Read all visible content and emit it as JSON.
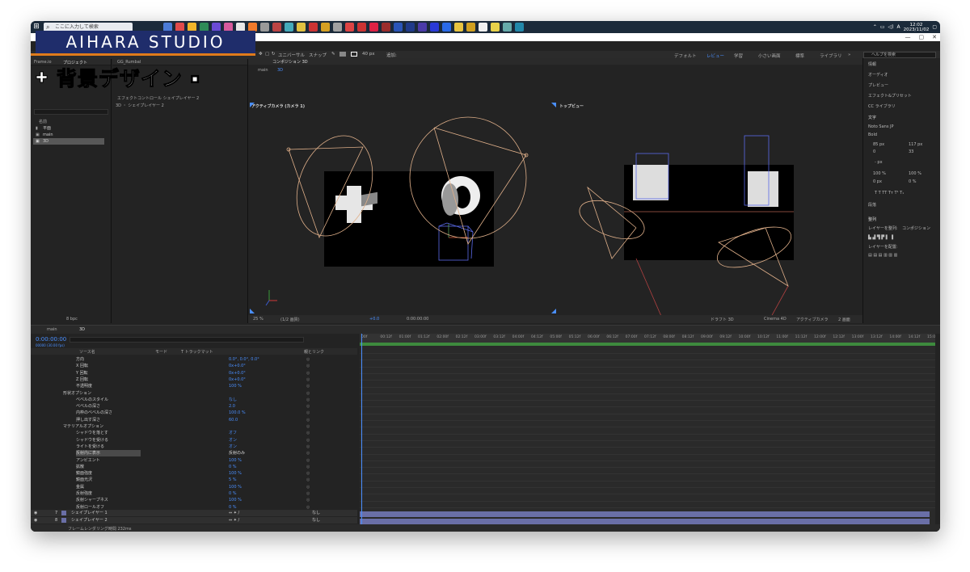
{
  "taskbar": {
    "search_placeholder": "ここに入力して検索",
    "time": "12:02",
    "date": "2023/11/02",
    "ime": "A",
    "icon_colors": [
      "#4b7bd6",
      "#e04b4b",
      "#f0b429",
      "#2e8b57",
      "#6a4bd6",
      "#d65a9c",
      "#e8e8e8",
      "#f07a2a",
      "#999",
      "#b44",
      "#4ab",
      "#e0c040",
      "#c33",
      "#d5a022",
      "#a0a0a0",
      "#d44",
      "#c33",
      "#d24",
      "#9b2d2d",
      "#2a55b8",
      "#1f3a8a",
      "#4a3aa8",
      "#2a3ad8",
      "#2a6ae8",
      "#e8c440",
      "#d0a020",
      "#f0f0f0",
      "#e8d24a",
      "#6aa",
      "#28a"
    ]
  },
  "watermark": "AIHARA STUDIO",
  "heading": "背景デザイン",
  "toolbar": {
    "universal": "ユニバーサル",
    "snap": "スナップ",
    "size": "40 px",
    "add": "追加:",
    "workspaces": [
      "デフォルト",
      "レビュー",
      "学習",
      "小さい画面",
      "標準",
      "ライブラリ"
    ],
    "active_workspace": "レビュー",
    "help_placeholder": "ヘルプを検索"
  },
  "project_panel": {
    "tabs": [
      "Frame.io",
      "プロジェクト"
    ],
    "second_tab": "GG_Rumbal",
    "effects_label": "エフェクトコントロール シェイプレイヤー 2",
    "layer_label": "3D ・ シェイプレイヤー 2",
    "name_header": "名前",
    "items": [
      {
        "icon": "folder-icon",
        "label": "平面"
      },
      {
        "icon": "comp-icon",
        "label": "main"
      },
      {
        "icon": "comp-icon",
        "label": "3D"
      }
    ],
    "bottom_bit": "8 bpc"
  },
  "composition": {
    "tab": "コンポジション 3D",
    "breadcrumb": [
      "main",
      "3D"
    ],
    "left_view": "アクティブカメラ (カメラ 1)",
    "right_view": "トップビュー",
    "zoom": "25 %",
    "quality": "(1/2 画質)",
    "exposure": "+0.0",
    "timecode": "0:00:00:00",
    "renderer_label": "レンダラー:",
    "renderer": "Cinema 4D",
    "camera": "アクティブカメラ",
    "views": "2 画面",
    "draft": "ドラフト 3D"
  },
  "right_panel": {
    "items": [
      "情報",
      "オーディオ",
      "プレビュー",
      "エフェクト&プリセット",
      "CC ライブラリ"
    ],
    "char_title": "文字",
    "font": "Noto Sans JP",
    "weight": "Bold",
    "font_size": "85 px",
    "leading": "117 px",
    "kerning": "0",
    "tracking": "33",
    "stroke": "- px",
    "vscale": "100 %",
    "hscale": "100 %",
    "baseline": "0 px",
    "tsume": "0 %",
    "paragraph": "段落",
    "align_title": "整列",
    "align_to_label": "レイヤーを整列:",
    "align_to": "コンポジション",
    "distribute_label": "レイヤーを配置:"
  },
  "timeline": {
    "tabs": [
      "main",
      "3D"
    ],
    "timecode": "0:00:00:00",
    "fps": "00000 (30.00 fps)",
    "headers": {
      "source": "ソース名",
      "mode": "モード",
      "track": "T トラックマット",
      "parent": "親とリンク"
    },
    "properties": [
      {
        "indent": 3,
        "name": "方向",
        "value": "0.0°, 0.0°, 0.0°"
      },
      {
        "indent": 3,
        "name": "X 回転",
        "value": "0x+0.0°"
      },
      {
        "indent": 3,
        "name": "Y 回転",
        "value": "0x+0.0°"
      },
      {
        "indent": 3,
        "name": "Z 回転",
        "value": "0x+0.0°"
      },
      {
        "indent": 3,
        "name": "不透明度",
        "value": "100 %"
      },
      {
        "indent": 2,
        "name": "形状オプション",
        "value": ""
      },
      {
        "indent": 3,
        "name": "ベベルのスタイル",
        "value": "なし"
      },
      {
        "indent": 3,
        "name": "ベベルの深さ",
        "value": "2.0"
      },
      {
        "indent": 3,
        "name": "内枠のベベルの深さ",
        "value": "100.0 %"
      },
      {
        "indent": 3,
        "name": "押し出す深さ",
        "value": "60.0"
      },
      {
        "indent": 2,
        "name": "マテリアルオプション",
        "value": ""
      },
      {
        "indent": 3,
        "name": "シャドウを落とす",
        "value": "オフ"
      },
      {
        "indent": 3,
        "name": "シャドウを受ける",
        "value": "オン"
      },
      {
        "indent": 3,
        "name": "ライトを受ける",
        "value": "オン"
      },
      {
        "indent": 3,
        "name": "反射内に表示",
        "value": "反射のみ"
      },
      {
        "indent": 3,
        "name": "アンビエント",
        "value": "100 %"
      },
      {
        "indent": 3,
        "name": "拡散",
        "value": "0 %"
      },
      {
        "indent": 3,
        "name": "鏡面強度",
        "value": "100 %"
      },
      {
        "indent": 3,
        "name": "鏡面光沢",
        "value": "5 %"
      },
      {
        "indent": 3,
        "name": "金属",
        "value": "100 %"
      },
      {
        "indent": 3,
        "name": "反射強度",
        "value": "0 %"
      },
      {
        "indent": 3,
        "name": "反射シャープネス",
        "value": "100 %"
      },
      {
        "indent": 3,
        "name": "反射ロールオフ",
        "value": "0 %"
      }
    ],
    "layers": [
      {
        "num": "7",
        "name": "シェイプレイヤー 1",
        "parent": "なし"
      },
      {
        "num": "8",
        "name": "シェイプレイヤー 2",
        "parent": "なし"
      }
    ],
    "render_time": "フレームレンダリング時間  232ms",
    "ruler_ticks": [
      "00f",
      "00:12f",
      "01:00f",
      "01:12f",
      "02:00f",
      "02:12f",
      "03:00f",
      "03:12f",
      "04:00f",
      "04:12f",
      "05:00f",
      "05:12f",
      "06:00f",
      "06:12f",
      "07:00f",
      "07:12f",
      "08:00f",
      "08:12f",
      "09:00f",
      "09:12f",
      "10:00f",
      "10:12f",
      "11:00f",
      "11:12f",
      "12:00f",
      "12:12f",
      "13:00f",
      "13:12f",
      "14:00f",
      "14:12f",
      "15:0"
    ]
  },
  "colors": {
    "accent": "#4a8fff",
    "work_area": "#3d8a3d",
    "layer_bar": "#6a6fa7",
    "camera_lines": "#e0b08a",
    "watermark_bg": "#1f2d6b",
    "orange": "#e07b1b"
  }
}
